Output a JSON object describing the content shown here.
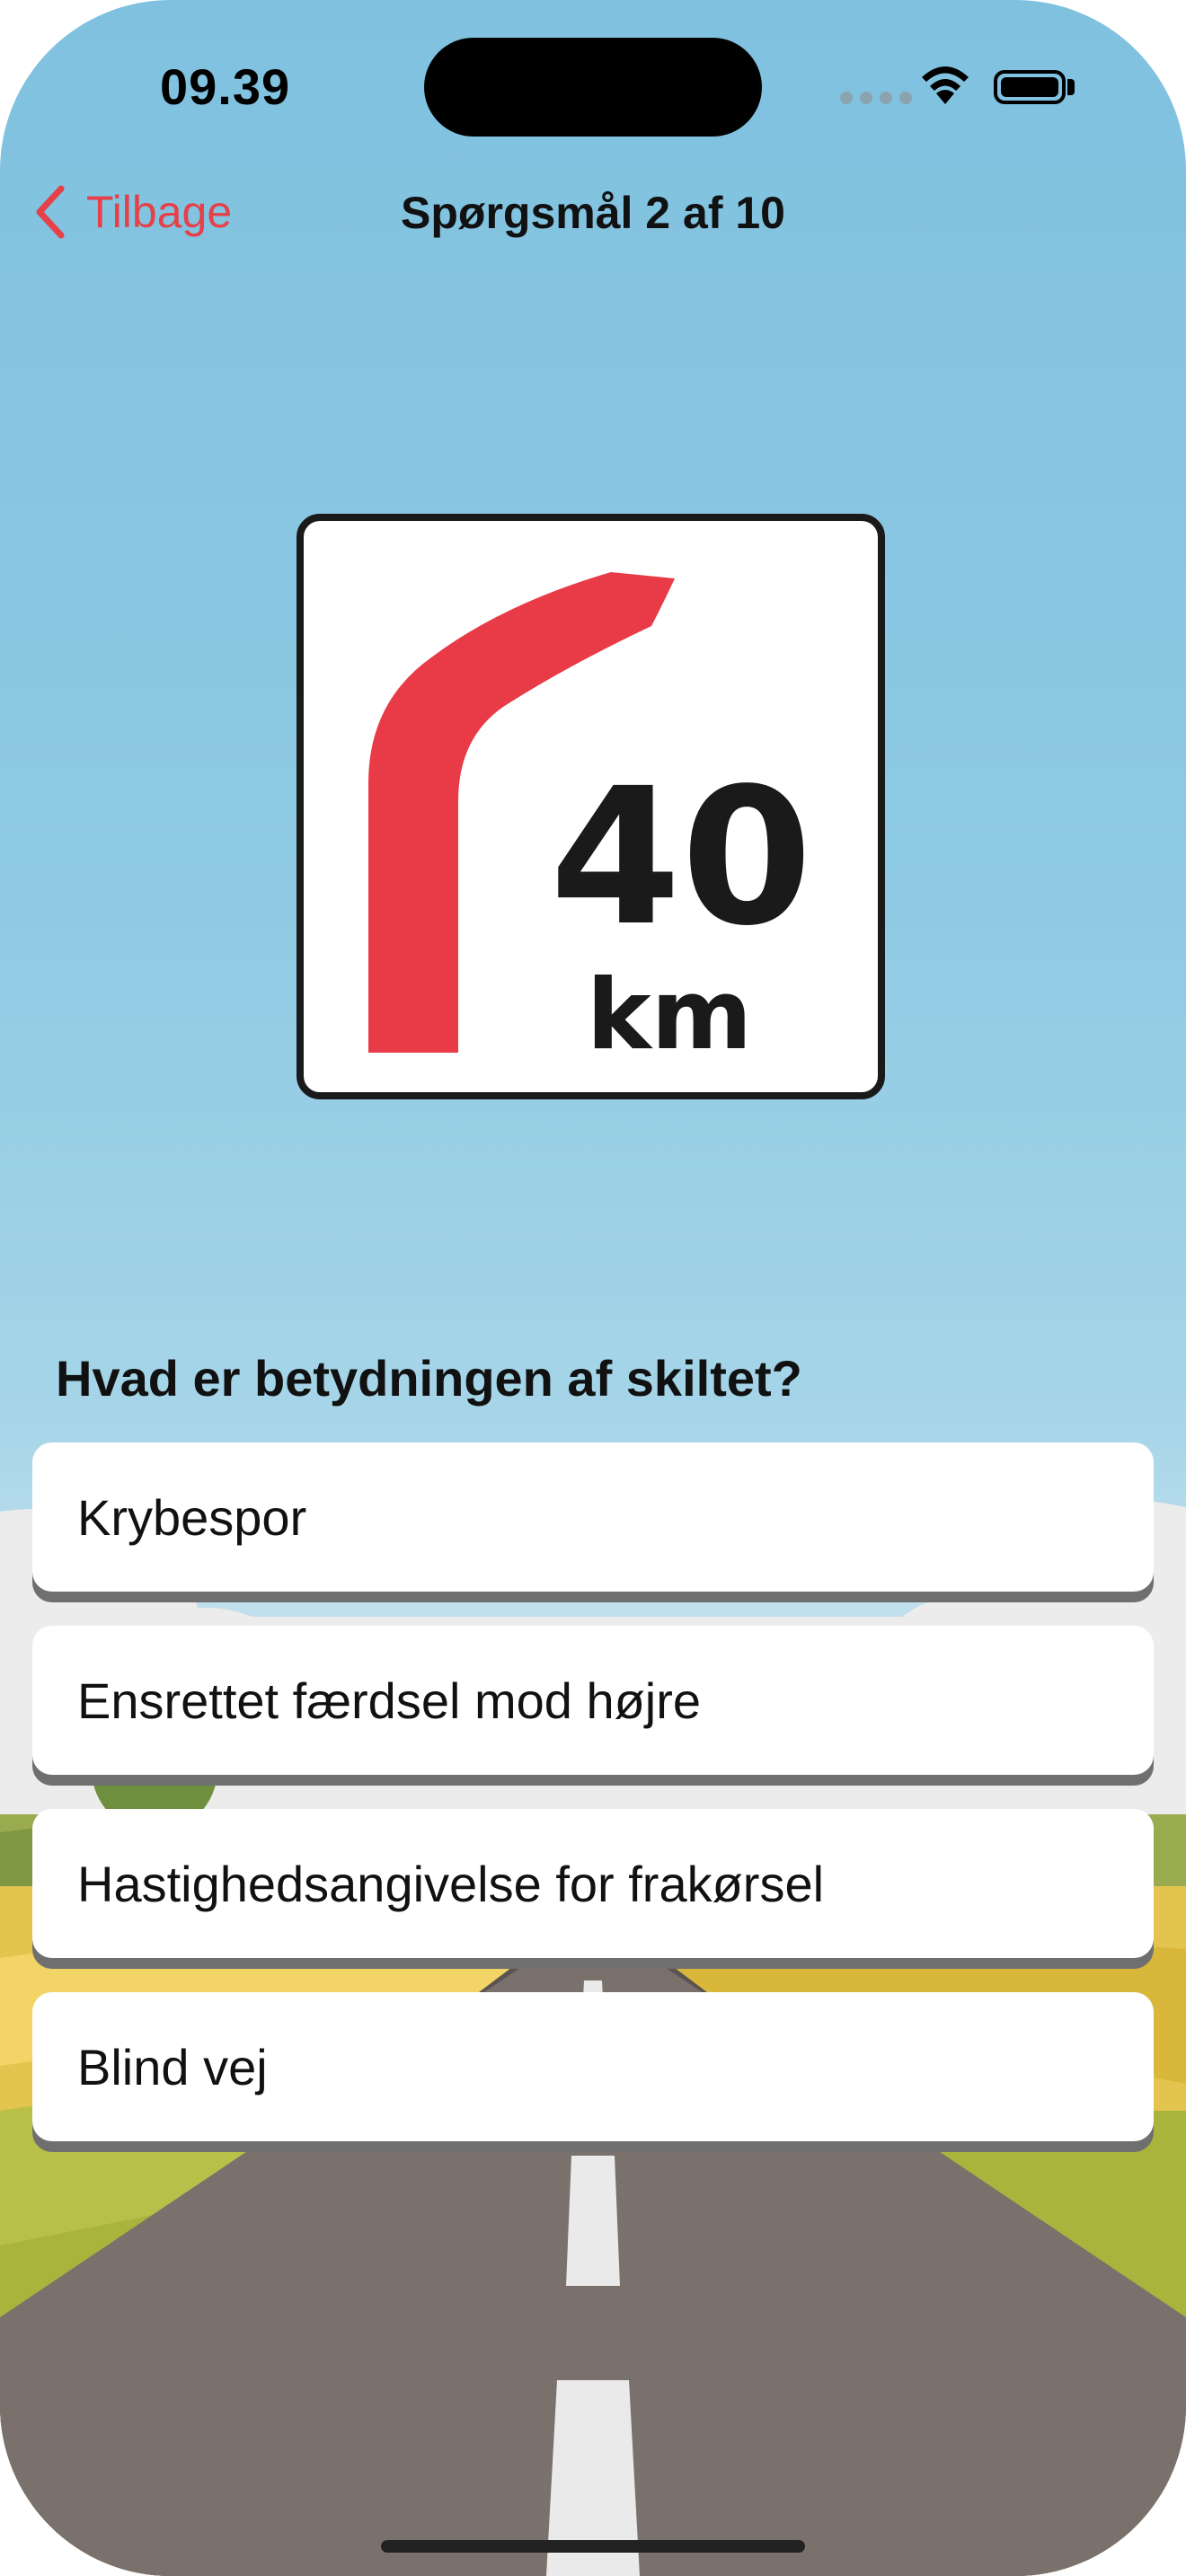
{
  "status_bar": {
    "time": "09.39"
  },
  "nav": {
    "back_label": "Tilbage",
    "title": "Spørgsmål 2 af 10"
  },
  "sign": {
    "number": "40",
    "unit": "km",
    "icon": "curve-left-arrow"
  },
  "question": {
    "text": "Hvad er betydningen af skiltet?"
  },
  "answers": [
    {
      "label": "Krybespor"
    },
    {
      "label": "Ensrettet færdsel mod højre"
    },
    {
      "label": "Hastighedsangivelse for frakørsel"
    },
    {
      "label": "Blind vej"
    }
  ],
  "colors": {
    "accent": "#e64048",
    "sign_red": "#e83b47",
    "sky": "#86c5e1",
    "road": "#7a716c"
  }
}
